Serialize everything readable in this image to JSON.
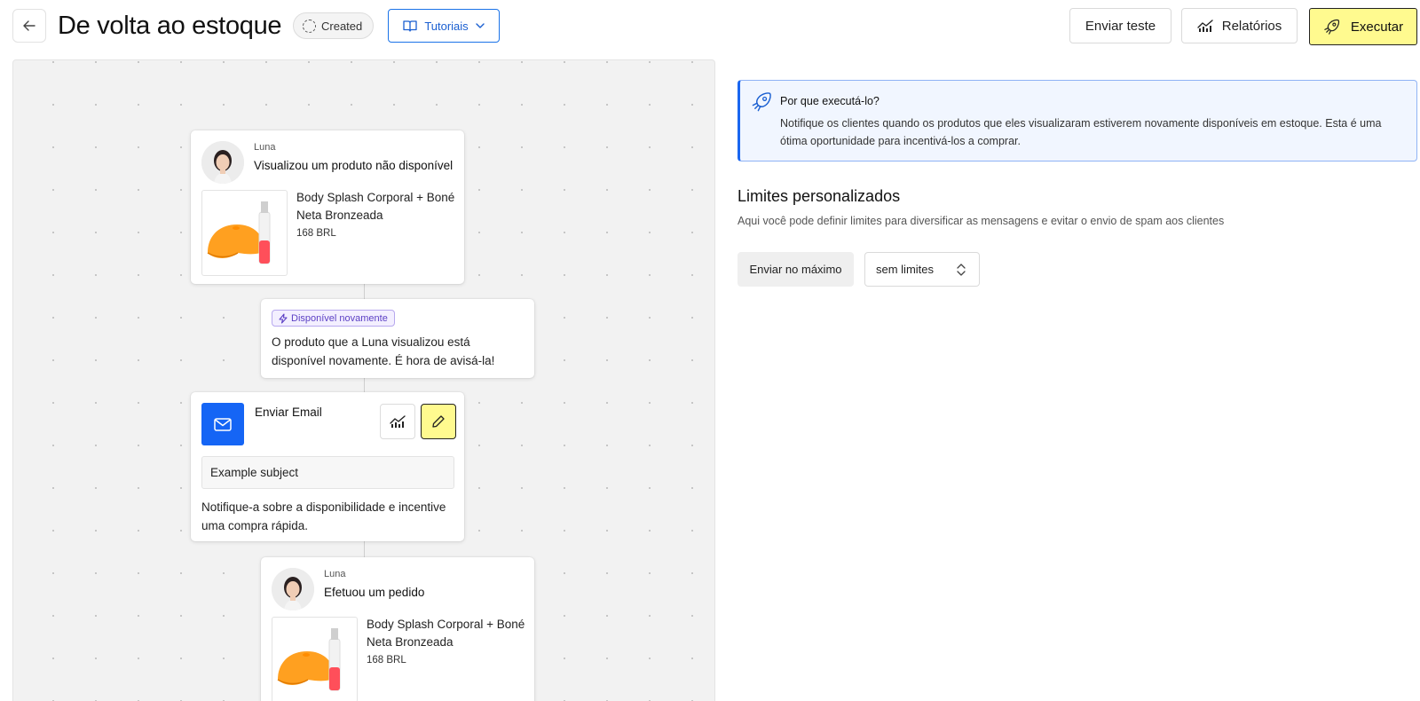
{
  "header": {
    "title": "De volta ao estoque",
    "status": "Created",
    "tutorials_label": "Tutoriais",
    "send_test_label": "Enviar teste",
    "reports_label": "Relatórios",
    "run_label": "Executar"
  },
  "flow": {
    "view_card": {
      "user": "Luna",
      "event": "Visualizou um produto não disponível",
      "product_name": "Body Splash Corporal + Boné Neta Bronzeada",
      "price": "168 BRL"
    },
    "trigger_card": {
      "badge": "Disponível novamente",
      "text": "O produto que a Luna visualizou está disponível novamente. É hora de avisá-la!"
    },
    "email_card": {
      "title": "Enviar Email",
      "subject": "Example subject",
      "description": "Notifique-a sobre a disponibilidade e incentive uma compra rápida."
    },
    "order_card": {
      "user": "Luna",
      "event": "Efetuou um pedido",
      "product_name": "Body Splash Corporal + Boné Neta Bronzeada",
      "price": "168 BRL"
    }
  },
  "info": {
    "title": "Por que executá-lo?",
    "text": "Notifique os clientes quando os produtos que eles visualizaram estiverem novamente disponíveis em estoque. Esta é uma ótima oportunidade para incentivá-los a comprar."
  },
  "limits": {
    "title": "Limites personalizados",
    "description": "Aqui você pode definir limites para diversificar as mensagens e evitar o envio de spam aos clientes",
    "send_max_label": "Enviar no máximo",
    "selected_value": "sem limites"
  },
  "colors": {
    "accent_yellow": "#fffa8f",
    "primary_blue": "#1565f5",
    "info_bg": "#f1f6ff",
    "canvas_bg": "#f2f2f2"
  },
  "icons": [
    "back-arrow-icon",
    "dashed-circle-icon",
    "book-icon",
    "chevron-down-icon",
    "chart-icon",
    "rocket-icon",
    "bolt-icon",
    "mail-icon",
    "pencil-icon",
    "updown-chevron-icon"
  ]
}
